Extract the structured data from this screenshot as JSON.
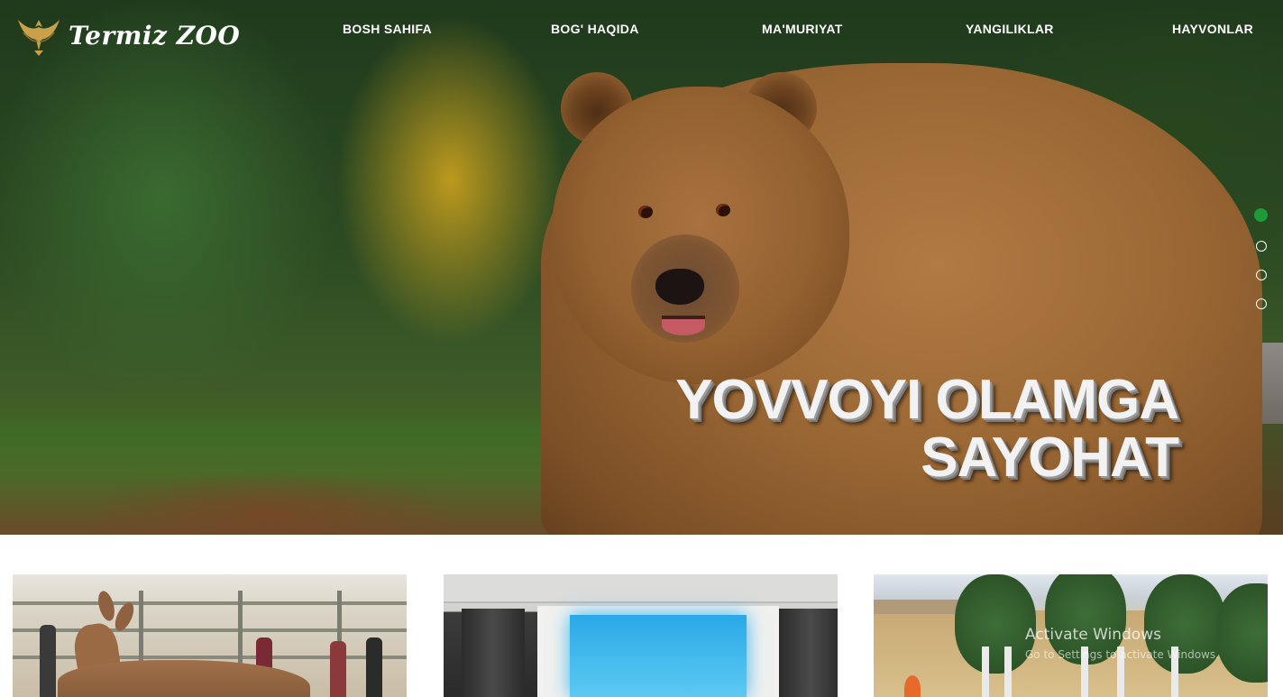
{
  "brand": {
    "name": "Termiz ZOO",
    "logo_icon": "eagle-emblem-icon",
    "logo_color": "#c9a14a"
  },
  "nav": {
    "items": [
      {
        "label": "BOSH SAHIFA"
      },
      {
        "label": "BOG' HAQIDA"
      },
      {
        "label": "MA'MURIYAT"
      },
      {
        "label": "YANGILIKLAR"
      },
      {
        "label": "HAYVONLAR"
      }
    ]
  },
  "hero": {
    "title_line1": "YOVVOYI OLAMGA",
    "title_line2": "SAYOHAT",
    "slides_count": 4,
    "active_slide": 1,
    "active_dot_color": "#1f9a39"
  },
  "cards": [
    {
      "subject": "deer-in-enclosure"
    },
    {
      "subject": "conference-room-projector"
    },
    {
      "subject": "zoo-grounds-trees"
    }
  ],
  "os_overlay": {
    "watermark_line1": "Activate Windows",
    "watermark_line2": "Go to Settings to activate Windows."
  }
}
